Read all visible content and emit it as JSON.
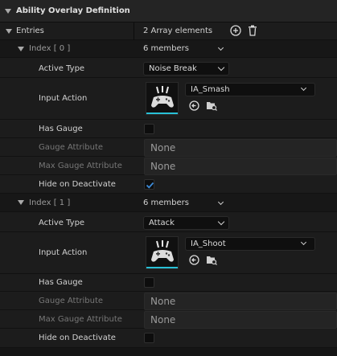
{
  "header": {
    "title": "Ability Overlay Definition"
  },
  "entries": {
    "label": "Entries",
    "count_text": "2 Array elements"
  },
  "items": [
    {
      "index_label": "Index [ 0 ]",
      "members_text": "6 members",
      "active_type_label": "Active Type",
      "active_type_value": "Noise Break",
      "input_action_label": "Input Action",
      "input_action_value": "IA_Smash",
      "has_gauge_label": "Has Gauge",
      "has_gauge": false,
      "gauge_attribute_label": "Gauge Attribute",
      "gauge_attribute_value": "None",
      "max_gauge_attribute_label": "Max Gauge Attribute",
      "max_gauge_attribute_value": "None",
      "hide_on_deactivate_label": "Hide on Deactivate",
      "hide_on_deactivate": true
    },
    {
      "index_label": "Index [ 1 ]",
      "members_text": "6 members",
      "active_type_label": "Active Type",
      "active_type_value": "Attack",
      "input_action_label": "Input Action",
      "input_action_value": "IA_Shoot",
      "has_gauge_label": "Has Gauge",
      "has_gauge": false,
      "gauge_attribute_label": "Gauge Attribute",
      "gauge_attribute_value": "None",
      "max_gauge_attribute_label": "Max Gauge Attribute",
      "max_gauge_attribute_value": "None",
      "hide_on_deactivate_label": "Hide on Deactivate",
      "hide_on_deactivate": false
    }
  ],
  "icons": {
    "add": "plus-circle-icon",
    "delete": "trash-icon",
    "browse": "arrow-left-circle-icon",
    "find": "folder-search-icon",
    "thumbnail": "gamepad-icon"
  },
  "colors": {
    "accent": "#28c0d6",
    "check": "#3d8bd8",
    "panel": "#1c1c1c"
  }
}
